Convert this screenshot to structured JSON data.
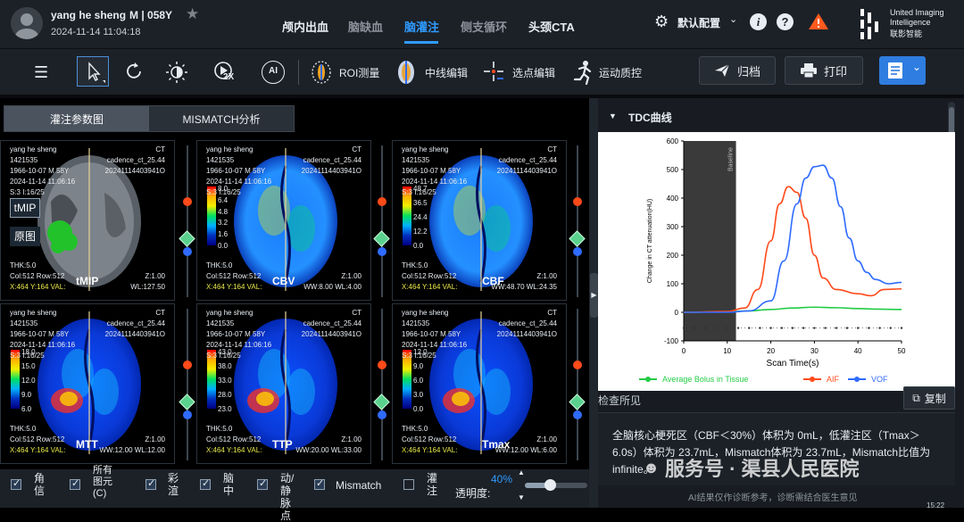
{
  "patient": {
    "name": "yang he sheng",
    "sex_age_id": "M | 058Y",
    "datetime": "2024-11-14 11:04:18"
  },
  "nav_tabs": [
    {
      "label": "颅内出血",
      "state": "normal"
    },
    {
      "label": "脑缺血",
      "state": "dim"
    },
    {
      "label": "脑灌注",
      "state": "active"
    },
    {
      "label": "侧支循环",
      "state": "dim"
    },
    {
      "label": "头颈CTA",
      "state": "normal"
    }
  ],
  "header": {
    "config_label": "默认配置",
    "brand_line1": "United Imaging",
    "brand_line2": "Intelligence",
    "brand_cn": "联影智能"
  },
  "toolbar": {
    "speed_badge": "2X",
    "roi_label": "ROI测量",
    "centerline_label": "中线编辑",
    "point_label": "选点编辑",
    "motion_label": "运动质控",
    "archive_label": "归档",
    "print_label": "打印"
  },
  "view_tabs": {
    "tab1": "灌注参数图",
    "tab2": "MISMATCH分析"
  },
  "image_panels": [
    {
      "name": "yang he sheng",
      "id": "1421535",
      "dob": "1966-10-07 M 58Y",
      "date": "2024-11-14 11:06:16",
      "slice": "S:3 I:16/25",
      "modality": "CT",
      "series": "cadence_ct_25.44",
      "study": "20241114403941O",
      "thk": "THK:5.0",
      "size": "Col:512 Row:512",
      "pos": "X:464 Y:164 VAL:",
      "zoom": "Z:1.00",
      "wl": "WL:127.50",
      "label": "tMIP",
      "overlay_btn1": "tMIP",
      "overlay_btn2": "原图"
    },
    {
      "name": "yang he sheng",
      "id": "1421535",
      "dob": "1966-10-07 M 58Y",
      "date": "2024-11-14 11:06:16",
      "slice": "S:3 I:16/25",
      "modality": "CT",
      "series": "cadence_ct_25.44",
      "study": "20241114403941O",
      "thk": "THK:5.0",
      "size": "Col:512 Row:512",
      "pos": "X:464 Y:164 VAL:",
      "zoom": "Z:1.00",
      "wl": "WW:8.00 WL:4.00",
      "label": "CBV",
      "scale": [
        "8.0",
        "6.4",
        "4.8",
        "3.2",
        "1.6",
        "0.0"
      ]
    },
    {
      "name": "yang he sheng",
      "id": "1421535",
      "dob": "1966-10-07 M 58Y",
      "date": "2024-11-14 11:06:16",
      "slice": "S:3 I:16/25",
      "modality": "CT",
      "series": "cadence_ct_25.44",
      "study": "20241114403941O",
      "thk": "THK:5.0",
      "size": "Col:512 Row:512",
      "pos": "X:464 Y:164 VAL:",
      "zoom": "Z:1.00",
      "wl": "WW:48.70 WL:24.35",
      "label": "CBF",
      "scale": [
        "48.7",
        "36.5",
        "24.4",
        "12.2",
        "0.0"
      ]
    },
    {
      "name": "yang he sheng",
      "id": "1421535",
      "dob": "1966-10-07 M 58Y",
      "date": "2024-11-14 11:06:16",
      "slice": "S:3 I:16/25",
      "modality": "CT",
      "series": "cadence_ct_25.44",
      "study": "20241114403941O",
      "thk": "THK:5.0",
      "size": "Col:512 Row:512",
      "pos": "X:464 Y:164 VAL:",
      "zoom": "Z:1.00",
      "wl": "WW:12.00 WL:12.00",
      "label": "MTT",
      "scale": [
        "18.0",
        "15.0",
        "12.0",
        "9.0",
        "6.0"
      ]
    },
    {
      "name": "yang he sheng",
      "id": "1421535",
      "dob": "1966-10-07 M 58Y",
      "date": "2024-11-14 11:06:16",
      "slice": "S:3 I:16/25",
      "modality": "CT",
      "series": "cadence_ct_25.44",
      "study": "20241114403941O",
      "thk": "THK:5.0",
      "size": "Col:512 Row:512",
      "pos": "X:464 Y:164 VAL:",
      "zoom": "Z:1.00",
      "wl": "WW:20.00 WL:33.00",
      "label": "TTP",
      "scale": [
        "43.0",
        "38.0",
        "33.0",
        "28.0",
        "23.0"
      ]
    },
    {
      "name": "yang he sheng",
      "id": "1421535",
      "dob": "1966-10-07 M 58Y",
      "date": "2024-11-14 11:06:16",
      "slice": "S:3 I:16/25",
      "modality": "CT",
      "series": "cadence_ct_25.44",
      "study": "20241114403941O",
      "thk": "THK:5.0",
      "size": "Col:512 Row:512",
      "pos": "X:464 Y:164 VAL:",
      "zoom": "Z:1.00",
      "wl": "WW:12.00 WL:6.00",
      "label": "Tmax",
      "scale": [
        "12.0",
        "9.0",
        "6.0",
        "3.0",
        "0.0"
      ]
    }
  ],
  "bottom_options": [
    {
      "label": "角信",
      "checked": true
    },
    {
      "label": "所有图元(C)",
      "checked": true
    },
    {
      "label": "彩渲",
      "checked": true
    },
    {
      "label": "脑中",
      "checked": true
    },
    {
      "label": "动/静脉点",
      "checked": true
    },
    {
      "label": "Mismatch",
      "checked": true
    },
    {
      "label": "灌注",
      "checked": false
    }
  ],
  "opacity": {
    "label": "透明度:",
    "value": "40%",
    "fraction": 0.4
  },
  "tdc": {
    "title": "TDC曲线"
  },
  "chart_data": {
    "type": "line",
    "xlabel": "Scan Time(s)",
    "ylabel": "Change in CT attenuation(HU)",
    "xlim": [
      0,
      50
    ],
    "ylim": [
      -100,
      600
    ],
    "xticks": [
      0,
      10,
      20,
      30,
      40,
      50
    ],
    "yticks": [
      -100,
      0,
      100,
      200,
      300,
      400,
      500,
      600
    ],
    "baseline": {
      "label": "Baseline",
      "x_range": [
        0,
        12
      ]
    },
    "series": [
      {
        "name": "Average Bolus in Tissue",
        "color": "#22cc44",
        "x": [
          0,
          10,
          15,
          20,
          25,
          30,
          35,
          40,
          45,
          50
        ],
        "y": [
          0,
          2,
          5,
          10,
          15,
          18,
          16,
          13,
          11,
          10
        ]
      },
      {
        "name": "AIF",
        "color": "#ff4a1a",
        "x": [
          0,
          10,
          14,
          17,
          20,
          22,
          24,
          26,
          28,
          30,
          32,
          35,
          40,
          43,
          46,
          50
        ],
        "y": [
          0,
          3,
          15,
          80,
          250,
          380,
          440,
          420,
          330,
          200,
          120,
          80,
          65,
          58,
          80,
          82
        ]
      },
      {
        "name": "VOF",
        "color": "#2f6bff",
        "x": [
          0,
          10,
          15,
          20,
          23,
          26,
          28,
          30,
          32,
          34,
          36,
          38,
          40,
          42,
          44,
          47,
          50
        ],
        "y": [
          0,
          0,
          5,
          40,
          180,
          380,
          470,
          510,
          515,
          470,
          370,
          260,
          180,
          140,
          115,
          100,
          105
        ]
      },
      {
        "name": "",
        "color": "#333333",
        "style": "dotted",
        "x": [
          0,
          2.5,
          5,
          7.5,
          10,
          12.5,
          15,
          17.5,
          20,
          22.5,
          25,
          27.5,
          30,
          32.5,
          35,
          37.5,
          40,
          42.5,
          45,
          47.5,
          50
        ],
        "y": [
          -55,
          -55,
          -55,
          -55,
          -55,
          -55,
          -55,
          -55,
          -55,
          -55,
          -55,
          -55,
          -55,
          -55,
          -55,
          -55,
          -55,
          -55,
          -55,
          -55,
          -55
        ]
      }
    ]
  },
  "findings": {
    "title": "检查所见",
    "copy_label": "复制",
    "text": "全脑核心梗死区（CBF＜30%）体积为 0mL，低灌注区（Tmax＞6.0s）体积为 23.7mL，Mismatch体积为 23.7mL，Mismatch比值为 infinite。",
    "watermark": "服务号 · 渠县人民医院",
    "disclaimer": "AI结果仅作诊断参考，诊断需结合医生意见",
    "clock": "15:22"
  },
  "colors": {
    "accent": "#2f9bff",
    "red_handle": "#ff4a1a",
    "blue_handle": "#2f6bff",
    "green_handle": "#5ad28e"
  }
}
